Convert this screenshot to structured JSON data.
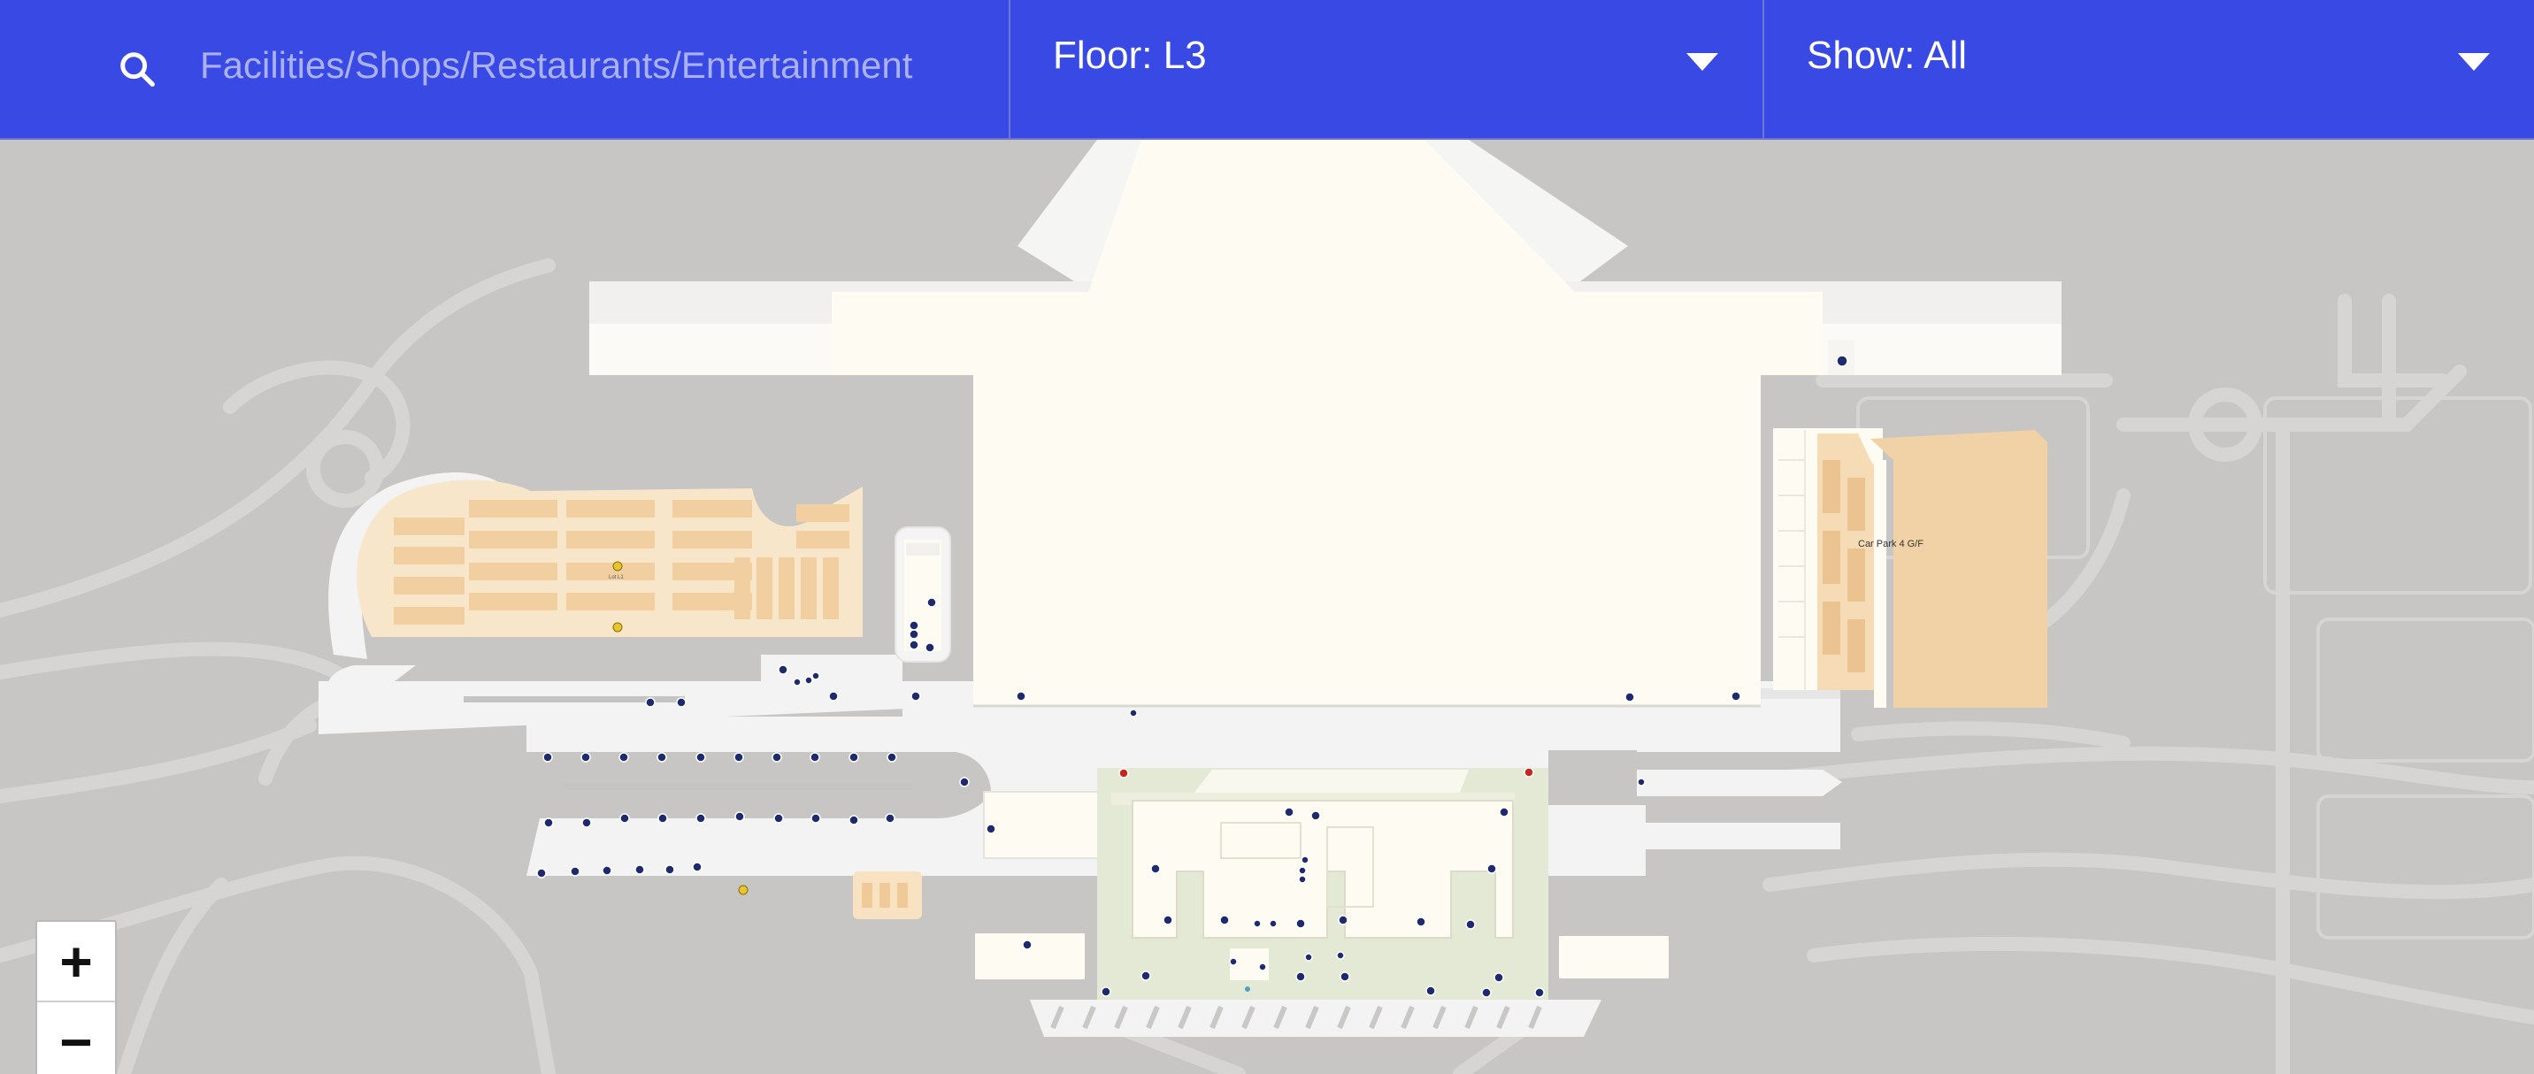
{
  "header": {
    "search": {
      "placeholder": "Facilities/Shops/Restaurants/Entertainment",
      "icon": "search-icon"
    },
    "floor": {
      "prefix": "Floor: ",
      "value": "L3",
      "icon": "chevron-down-icon"
    },
    "show": {
      "prefix": "Show: ",
      "value": "All",
      "icon": "chevron-down-icon"
    }
  },
  "map": {
    "labels": {
      "car_park": "Car Park 4 G/F",
      "small_lot": "Lot L1"
    },
    "colors": {
      "bar": "#3849e4",
      "terminal": "#fdfbf2",
      "carpark": "#f0d2a6",
      "road": "#f3f3f4",
      "background": "#c7c6c5",
      "marker": "#1d2a6e",
      "alert": "#c7261e",
      "parking": "#e8c430",
      "green": "#e2e8d4"
    }
  },
  "zoom": {
    "in_label": "+",
    "out_label": "−"
  }
}
